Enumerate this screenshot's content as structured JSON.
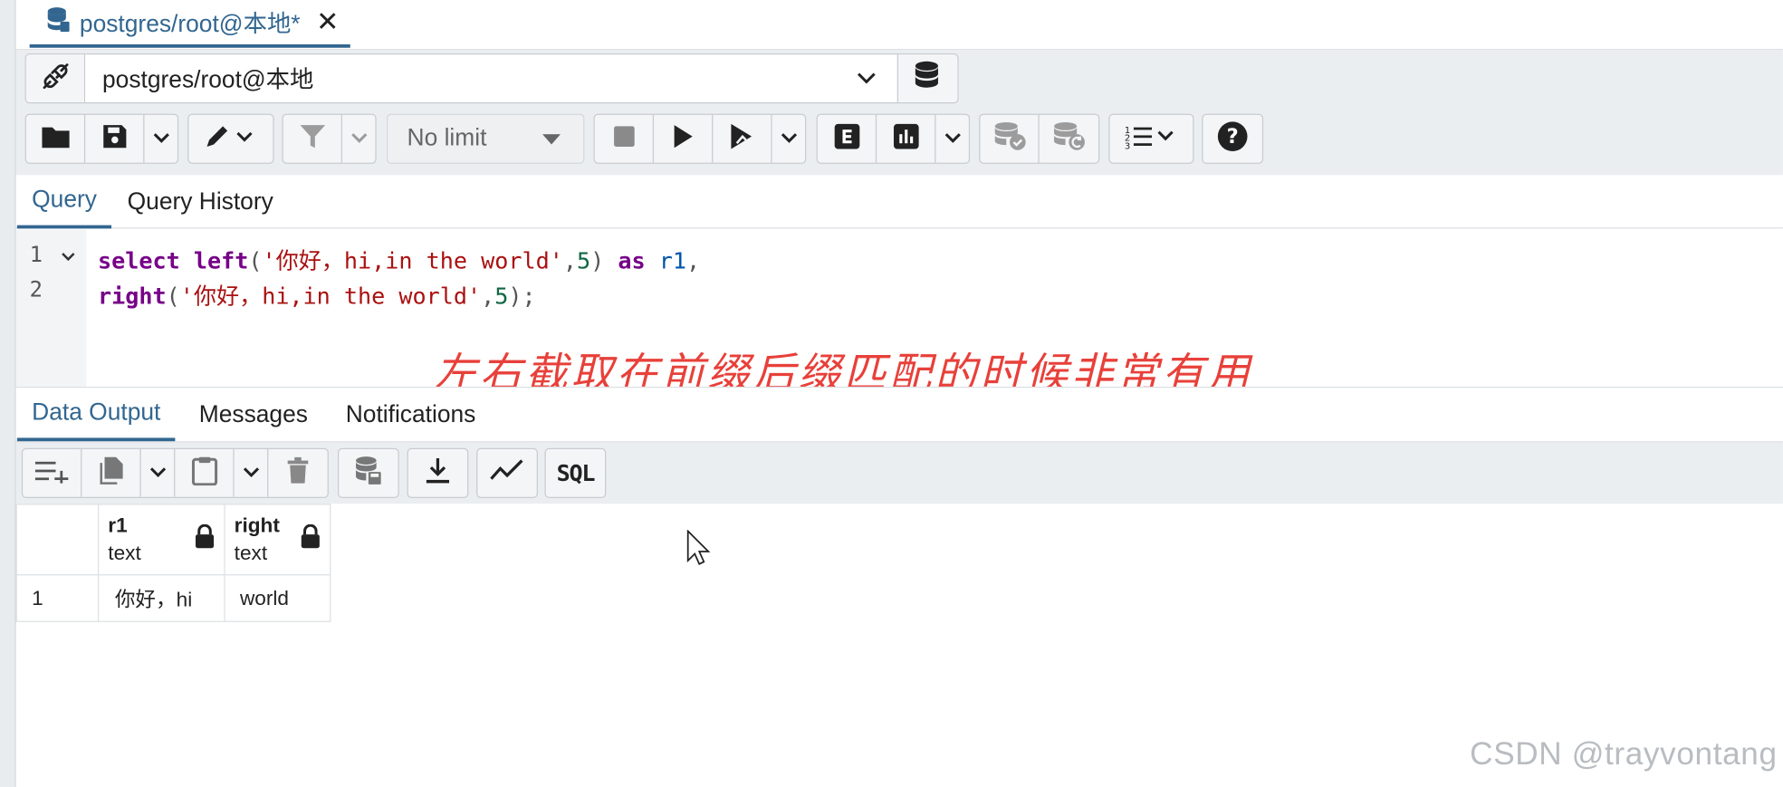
{
  "tab": {
    "title": "postgres/root@本地*",
    "close_label": "✕"
  },
  "connection": {
    "selected": "postgres/root@本地"
  },
  "toolbar": {
    "limit_label": "No limit"
  },
  "query_tabs": [
    {
      "label": "Query"
    },
    {
      "label": "Query History"
    }
  ],
  "editor": {
    "line_numbers": [
      "1",
      "2"
    ],
    "line1": [
      {
        "t": "select",
        "c": "kw"
      },
      {
        "t": " ",
        "c": ""
      },
      {
        "t": "left",
        "c": "fn"
      },
      {
        "t": "(",
        "c": "punct"
      },
      {
        "t": "'你好，hi,in the world'",
        "c": "str"
      },
      {
        "t": ",",
        "c": "punct"
      },
      {
        "t": "5",
        "c": "num"
      },
      {
        "t": ")",
        "c": "punct"
      },
      {
        "t": " ",
        "c": ""
      },
      {
        "t": "as",
        "c": "kw"
      },
      {
        "t": " ",
        "c": ""
      },
      {
        "t": "r1",
        "c": "ident"
      },
      {
        "t": ",",
        "c": "punct"
      }
    ],
    "line2": [
      {
        "t": "right",
        "c": "fn"
      },
      {
        "t": "(",
        "c": "punct"
      },
      {
        "t": "'你好，hi,in the world'",
        "c": "str"
      },
      {
        "t": ",",
        "c": "punct"
      },
      {
        "t": "5",
        "c": "num"
      },
      {
        "t": ");",
        "c": "punct"
      }
    ]
  },
  "caption": "左右截取在前缀后缀匹配的时候非常有用",
  "output_tabs": [
    {
      "label": "Data Output"
    },
    {
      "label": "Messages"
    },
    {
      "label": "Notifications"
    }
  ],
  "grid": {
    "columns": [
      {
        "name": "r1",
        "type": "text"
      },
      {
        "name": "right",
        "type": "text"
      }
    ],
    "rows": [
      {
        "num": "1",
        "cells": [
          "你好，hi",
          "world"
        ]
      }
    ]
  },
  "sql_button_label": "SQL",
  "watermark": "CSDN @trayvontang",
  "colors": {
    "accent": "#326690",
    "caption": "#e8403a",
    "keyword": "#770088",
    "string": "#aa1111",
    "number": "#116644"
  }
}
